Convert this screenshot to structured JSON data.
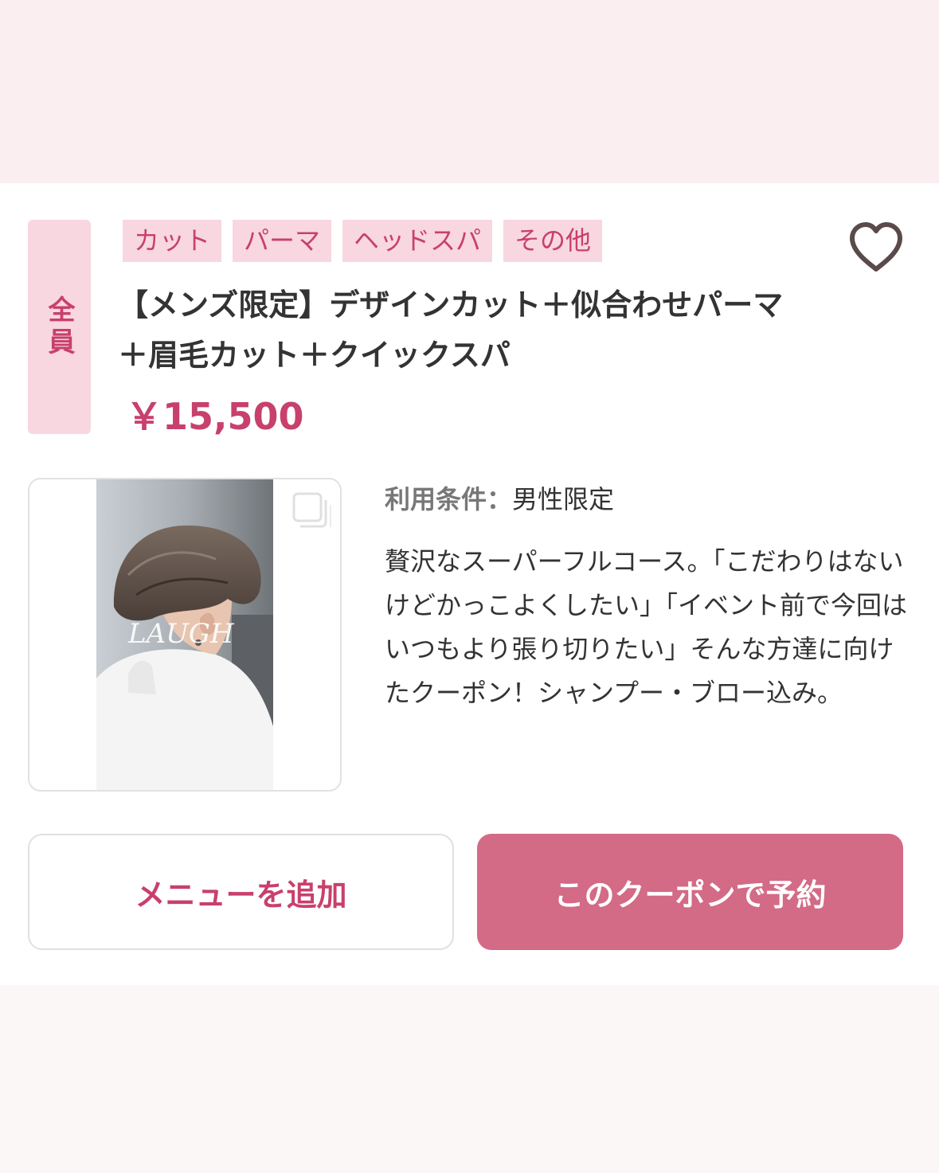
{
  "colors": {
    "accent": "#c8406c",
    "tag_bg": "#f8d7e0",
    "reserve_button": "#d36a86"
  },
  "coupon": {
    "target": "全員",
    "tags": [
      "カット",
      "パーマ",
      "ヘッドスパ",
      "その他"
    ],
    "title_line1": "【メンズ限定】デザインカット＋似合わせパーマ",
    "title_line2": "＋眉毛カット＋クイックスパ",
    "price": "￥15,500",
    "favorite_icon": "heart-icon",
    "photo_caption": "LAUGH",
    "gallery_icon": "gallery-icon",
    "conditions_label": "利用条件：",
    "conditions_value": "男性限定",
    "description": "贅沢なスーパーフルコース。「こだわりはないけどかっこよくしたい」「イベント前で今回はいつもより張り切りたい」そんな方達に向けたクーポン！シャンプー・ブロー込み。"
  },
  "actions": {
    "add_menu": "メニューを追加",
    "reserve": "このクーポンで予約"
  }
}
